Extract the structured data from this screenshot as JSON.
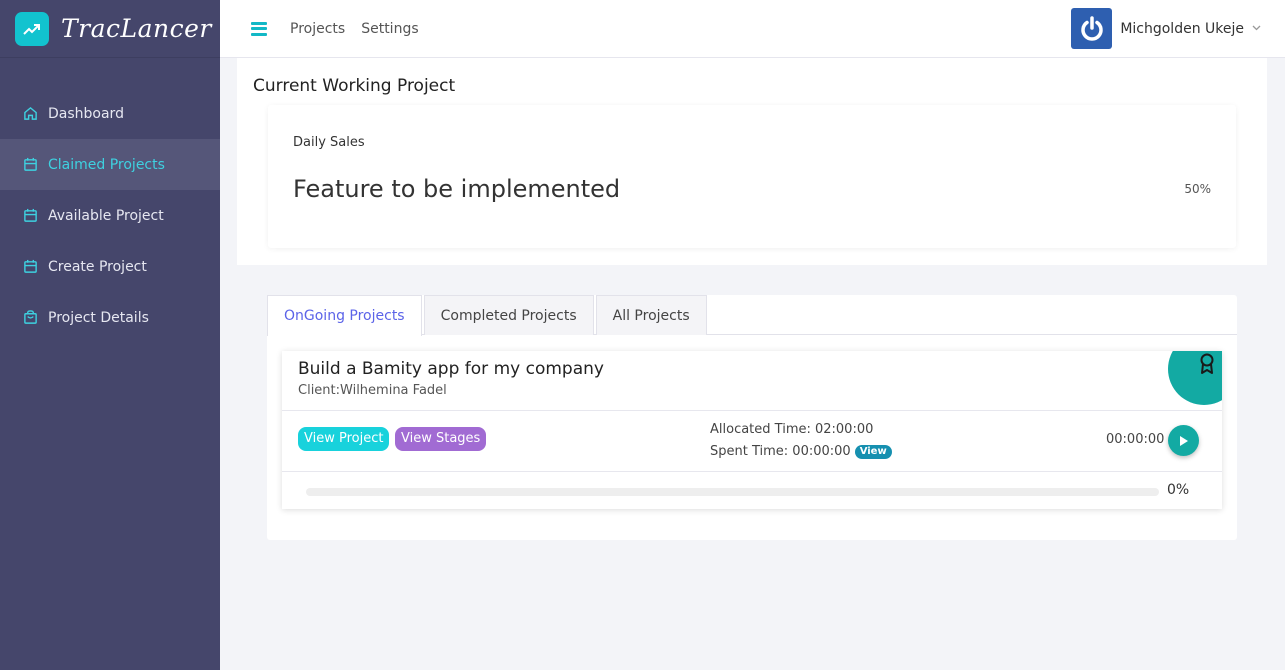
{
  "brand": {
    "name": "TracLancer",
    "logo_icon": "trending-up-icon"
  },
  "sidebar": {
    "items": [
      {
        "label": "Dashboard",
        "icon": "home-icon",
        "active": false
      },
      {
        "label": "Claimed Projects",
        "icon": "calendar-icon",
        "active": true
      },
      {
        "label": "Available Project",
        "icon": "calendar-icon",
        "active": false
      },
      {
        "label": "Create Project",
        "icon": "calendar-icon",
        "active": false
      },
      {
        "label": "Project Details",
        "icon": "bag-icon",
        "active": false
      }
    ]
  },
  "topbar": {
    "links": [
      "Projects",
      "Settings"
    ],
    "user": {
      "name": "Michgolden Ukeje",
      "avatar_icon": "power-icon"
    }
  },
  "current_project": {
    "heading": "Current Working Project",
    "label": "Daily Sales",
    "feature": "Feature to be implemented",
    "percent": "50%"
  },
  "tabs": {
    "items": [
      "OnGoing Projects",
      "Completed Projects",
      "All Projects"
    ],
    "active_index": 0
  },
  "project": {
    "title": "Build a Bamity app for my company",
    "client": "Client:Wilhemina Fadel",
    "view_project_label": "View Project",
    "view_stages_label": "View Stages",
    "allocated": "Allocated Time: 02:00:00",
    "spent": "Spent Time: 00:00:00",
    "view_badge": "View",
    "timer": "00:00:00",
    "progress_value": 0,
    "progress_label": "0%",
    "ribbon_icon": "award-icon"
  },
  "colors": {
    "sidebar_bg": "#45466b",
    "accent_teal": "#13aaa3",
    "accent_cyan": "#18d2dc",
    "accent_purple": "#a16bd3",
    "tab_active": "#5b63e8"
  }
}
